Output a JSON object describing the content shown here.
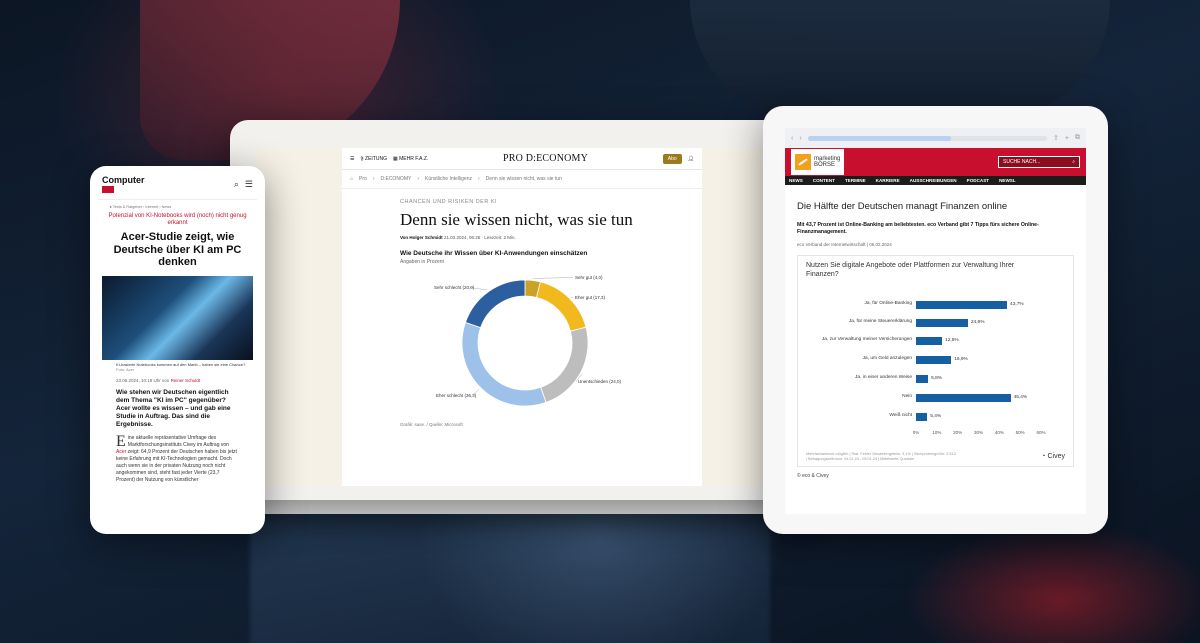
{
  "laptop": {
    "nav": {
      "zeitung": "ZEITUNG",
      "mehr": "MEHR F.A.Z.",
      "brand": "PRO D:ECONOMY",
      "abo": "Abo"
    },
    "breadcrumb": [
      "Pro",
      "D:ECONOMY",
      "Künstliche Intelligenz",
      "Denn sie wissen nicht, was sie tun"
    ],
    "kicker": "CHANCEN UND RISIKEN DER KI",
    "headline": "Denn sie wissen nicht, was sie tun",
    "byline": {
      "author": "Von Holger Schmidt",
      "meta": "21.03.2024, 06:26 · Lesezeit: 2 Min."
    },
    "chart": {
      "title": "Wie Deutsche ihr Wissen über KI-Anwendungen einschätzen",
      "subtitle": "Angaben in Prozent",
      "source": "Grafik: sase. / Quelle: Microsoft"
    }
  },
  "phone": {
    "brand_line1": "Computer",
    "brand_line2": "BILD",
    "breadcrumb": "▸  Tests & Ratgeber  ›  Internet  ›  News",
    "kicker": "Potenzial von KI-Notebooks wird (noch) nicht genug erkannt",
    "title": "Acer-Studie zeigt, wie Deutsche über KI am PC denken",
    "caption": "KI-basierte Notebooks kommen auf den Markt – haben sie eine Chance?",
    "caption_credit": "Foto: Acer",
    "date": "23.06.2024, 10:19 Uhr von",
    "author": "Reiner Schuldt",
    "lead": "Wie stehen wir Deutschen eigentlich dem Thema \"KI im PC\" gegenüber? Acer wollte es wissen – und gab eine Studie in Auftrag. Das sind die Ergebnisse.",
    "body_drop": "E",
    "body_a": "ine aktuelle repräsentative Umfrage des Marktforschungsinstituts Civey im Auftrag von ",
    "body_link": "Acer",
    "body_b": " zeigt: 64,9 Prozent der Deutschen haben bis jetzt keine Erfahrung mit KI-Technologien gemacht. Doch auch wenn sie in der privaten Nutzung noch nicht angekommen sind, steht fast jeder Vierte (23,7 Prozent) der Nutzung von künstlicher"
  },
  "tablet": {
    "brand_line1": "marketing",
    "brand_line2": "BÖRSE",
    "search_placeholder": "SUCHE NACH...",
    "nav": [
      "NEWS",
      "CONTENT",
      "TERMINE",
      "KARRIERE",
      "AUSSCHREIBUNGEN",
      "PODCAST",
      "NEWSL"
    ],
    "title": "Die Hälfte der Deutschen managt Finanzen online",
    "subtitle": "Mit 43,7 Prozent ist Online-Banking am beliebtesten. eco Verband gibt 7 Tipps fürs sichere Online-Finanzmanagement.",
    "meta": "eco Verband der Internetwirtschaft | 06.02.2024",
    "chart_title": "Nutzen Sie digitale Angebote oder Plattformen zur Verwaltung Ihrer Finanzen?",
    "chart_foot": "Mehrfachantwort möglich | Stat. Fehler Gesamtergebnis: 3,1% | Stichprobengröße: 2.513 | Befragungszeitraum: 04.01.24 - 05.01.24 | Mittelwerte Quartale",
    "civey_label": "Civey",
    "copyright": "© eco & Civey"
  },
  "colors": {
    "faz_gold": "#9b7a1e",
    "bild_red": "#c8102e",
    "civey_blue": "#165fa3",
    "donut_dark": "#2c5fa0",
    "donut_yellow": "#f2b91e",
    "donut_grey": "#bdbdbd",
    "donut_light": "#9ec1ea"
  },
  "icons": [
    "menu-icon",
    "search-icon",
    "user-icon",
    "home-icon",
    "back-icon",
    "forward-icon",
    "share-icon",
    "add-icon",
    "tabs-icon"
  ],
  "chart_data": [
    {
      "type": "pie",
      "title": "Wie Deutsche ihr Wissen über KI-Anwendungen einschätzen",
      "subtitle": "Angaben in Prozent",
      "categories": [
        "Sehr gut",
        "Eher gut",
        "Unentschieden",
        "Eher schlecht",
        "Sehr schlecht"
      ],
      "values": [
        4.0,
        17.3,
        24.0,
        36.3,
        20.0
      ],
      "labels": [
        "Sehr gut (4,0)",
        "Eher gut (17,3)",
        "Unentschieden (24,0)",
        "Eher schlecht (36,3)",
        "Sehr schlecht (20,0)"
      ]
    },
    {
      "type": "bar",
      "title": "Nutzen Sie digitale Angebote oder Plattformen zur Verwaltung Ihrer Finanzen?",
      "categories": [
        "Ja, für Online-Banking",
        "Ja, für meine Steuererklärung",
        "Ja, zur Verwaltung meiner Versicherungen",
        "Ja, um Geld anzulegen",
        "Ja, in einer anderen Weise",
        "Nein",
        "Weiß nicht"
      ],
      "values": [
        43.7,
        24.9,
        12.5,
        16.9,
        5.8,
        45.4,
        5.4
      ],
      "value_labels": [
        "43,7%",
        "24,9%",
        "12,5%",
        "16,9%",
        "5,8%",
        "45,4%",
        "5,4%"
      ],
      "xlim": [
        0,
        60
      ],
      "xticks": [
        "0%",
        "10%",
        "20%",
        "30%",
        "40%",
        "50%",
        "60%"
      ]
    }
  ]
}
